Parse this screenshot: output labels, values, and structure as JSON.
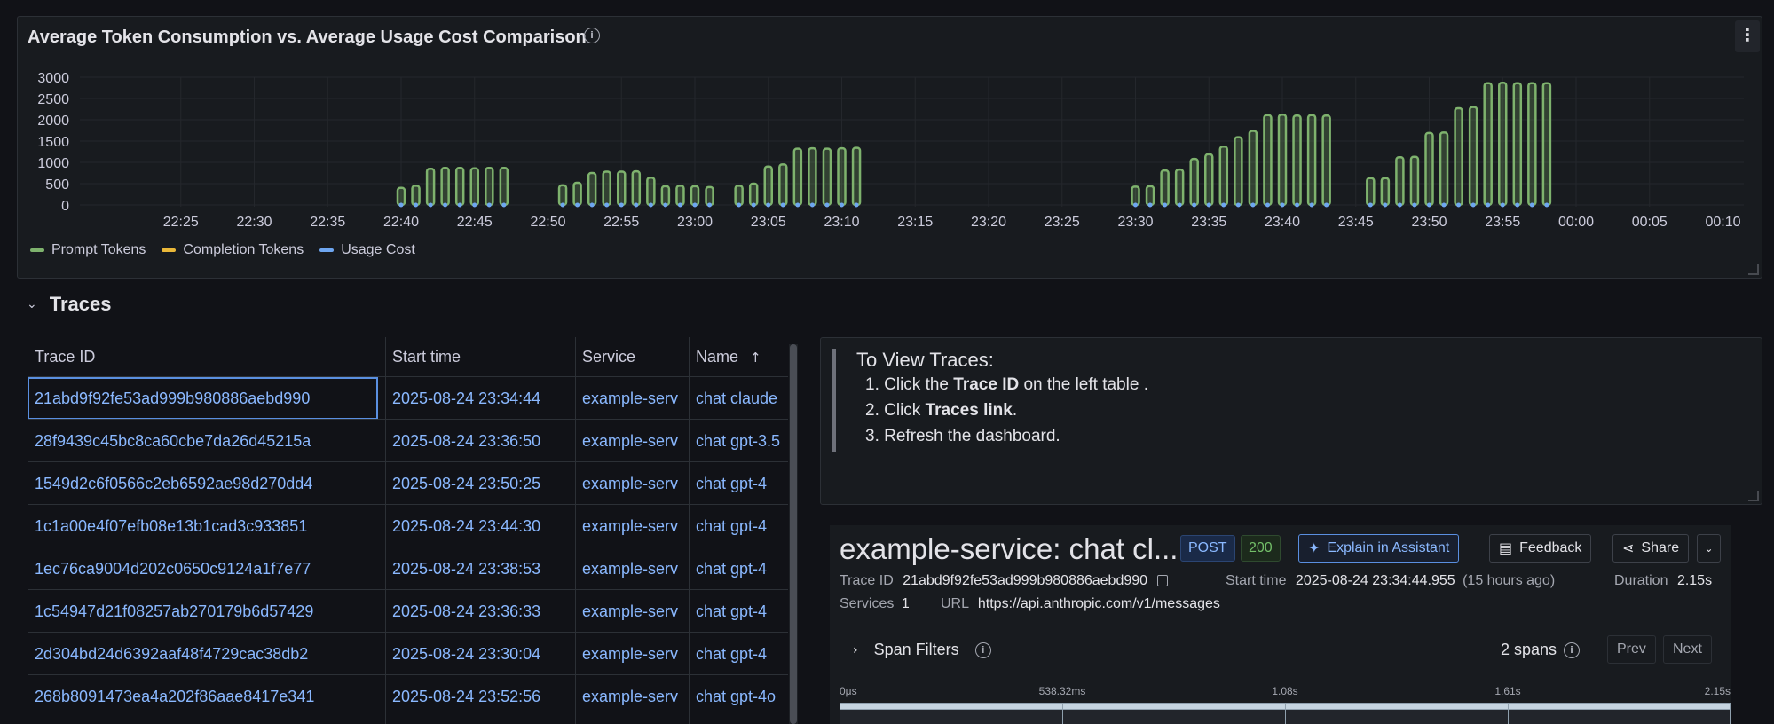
{
  "chart_panel": {
    "title": "Average Token Consumption vs. Average Usage Cost Comparison",
    "menu_icon": "⋮",
    "legend": [
      {
        "name": "Prompt Tokens",
        "color": "#7eb26d"
      },
      {
        "name": "Completion Tokens",
        "color": "#eab839"
      },
      {
        "name": "Usage Cost",
        "color": "#6ea6f0"
      }
    ]
  },
  "chart_data": {
    "type": "bar",
    "yticks": [
      0,
      500,
      1000,
      1500,
      2000,
      2500,
      3000
    ],
    "ylim": [
      0,
      3200
    ],
    "xticks": [
      "22:25",
      "22:30",
      "22:35",
      "22:40",
      "22:45",
      "22:50",
      "22:55",
      "23:00",
      "23:05",
      "23:10",
      "23:15",
      "23:20",
      "23:25",
      "23:30",
      "23:35",
      "23:40",
      "23:45",
      "23:50",
      "23:55",
      "00:00",
      "00:05",
      "00:10"
    ],
    "x_minutes_start": "22:20",
    "series": [
      {
        "name": "Prompt Tokens",
        "points": [
          [
            "22:40",
            400
          ],
          [
            "22:41",
            450
          ],
          [
            "22:42",
            850
          ],
          [
            "22:43",
            870
          ],
          [
            "22:44",
            870
          ],
          [
            "22:45",
            860
          ],
          [
            "22:46",
            870
          ],
          [
            "22:47",
            870
          ],
          [
            "22:51",
            460
          ],
          [
            "22:52",
            520
          ],
          [
            "22:53",
            750
          ],
          [
            "22:54",
            780
          ],
          [
            "22:55",
            780
          ],
          [
            "22:56",
            790
          ],
          [
            "22:57",
            640
          ],
          [
            "22:58",
            440
          ],
          [
            "22:59",
            450
          ],
          [
            "23:00",
            440
          ],
          [
            "23:01",
            420
          ],
          [
            "23:03",
            450
          ],
          [
            "23:04",
            500
          ],
          [
            "23:05",
            900
          ],
          [
            "23:06",
            950
          ],
          [
            "23:07",
            1320
          ],
          [
            "23:08",
            1330
          ],
          [
            "23:09",
            1320
          ],
          [
            "23:10",
            1330
          ],
          [
            "23:11",
            1340
          ],
          [
            "23:30",
            430
          ],
          [
            "23:31",
            440
          ],
          [
            "23:32",
            810
          ],
          [
            "23:33",
            830
          ],
          [
            "23:34",
            1080
          ],
          [
            "23:35",
            1190
          ],
          [
            "23:36",
            1370
          ],
          [
            "23:37",
            1590
          ],
          [
            "23:38",
            1740
          ],
          [
            "23:39",
            2110
          ],
          [
            "23:40",
            2120
          ],
          [
            "23:41",
            2100
          ],
          [
            "23:42",
            2110
          ],
          [
            "23:43",
            2100
          ],
          [
            "23:46",
            630
          ],
          [
            "23:47",
            630
          ],
          [
            "23:48",
            1120
          ],
          [
            "23:49",
            1130
          ],
          [
            "23:50",
            1690
          ],
          [
            "23:51",
            1700
          ],
          [
            "23:52",
            2270
          ],
          [
            "23:53",
            2300
          ],
          [
            "23:54",
            2860
          ],
          [
            "23:55",
            2870
          ],
          [
            "23:56",
            2860
          ],
          [
            "23:57",
            2860
          ],
          [
            "23:58",
            2860
          ]
        ]
      },
      {
        "name": "Completion Tokens",
        "note_values": "near 0"
      },
      {
        "name": "Usage Cost",
        "note_values": "near 0"
      }
    ]
  },
  "traces_row": {
    "title": "Traces",
    "chevron": "⌄"
  },
  "table": {
    "headers": [
      "Trace ID",
      "Start time",
      "Service",
      "Name"
    ],
    "sort_indicator": "↑",
    "rows": [
      [
        "21abd9f92fe53ad999b980886aebd990",
        "2025-08-24 23:34:44",
        "example-serv",
        "chat claude"
      ],
      [
        "28f9439c45bc8ca60cbe7da26d45215a",
        "2025-08-24 23:36:50",
        "example-serv",
        "chat gpt-3.5"
      ],
      [
        "1549d2c6f0566c2eb6592ae98d270dd4",
        "2025-08-24 23:50:25",
        "example-serv",
        "chat gpt-4"
      ],
      [
        "1c1a00e4f07efb08e13b1cad3c933851",
        "2025-08-24 23:44:30",
        "example-serv",
        "chat gpt-4"
      ],
      [
        "1ec76ca9004d202c0650c9124a1f7e77",
        "2025-08-24 23:38:53",
        "example-serv",
        "chat gpt-4"
      ],
      [
        "1c54947d21f08257ab270179b6d57429",
        "2025-08-24 23:36:33",
        "example-serv",
        "chat gpt-4"
      ],
      [
        "2d304bd24d6392aaf48f4729cac38db2",
        "2025-08-24 23:30:04",
        "example-serv",
        "chat gpt-4"
      ],
      [
        "268b8091473ea4a202f86aae8417e341",
        "2025-08-24 23:52:56",
        "example-serv",
        "chat gpt-4o"
      ]
    ]
  },
  "instructions": {
    "heading": "To View Traces:",
    "step1_pre": "1. Click the ",
    "step1_bold": "Trace ID",
    "step1_post": " on the left table .",
    "step2_pre": "2. Click ",
    "step2_bold": "Traces link",
    "step2_post": ".",
    "step3": "3. Refresh the dashboard."
  },
  "trace_detail": {
    "title": "example-service: chat cl...",
    "method": "POST",
    "status": "200",
    "assistant_label": "Explain in Assistant",
    "feedback_label": "Feedback",
    "share_label": "Share",
    "trace_id_label": "Trace ID",
    "trace_id": "21abd9f92fe53ad999b980886aebd990",
    "start_time_label": "Start time",
    "start_time": "2025-08-24 23:34:44.955",
    "start_time_rel": "(15 hours ago)",
    "duration_label": "Duration",
    "duration": "2.15s",
    "services_label": "Services",
    "services": "1",
    "url_label": "URL",
    "url": "https://api.anthropic.com/v1/messages",
    "span_filters_label": "Span Filters",
    "span_count": "2 spans",
    "prev_label": "Prev",
    "next_label": "Next",
    "timeline_ticks": [
      "0μs",
      "538.32ms",
      "1.08s",
      "1.61s",
      "2.15s"
    ]
  }
}
